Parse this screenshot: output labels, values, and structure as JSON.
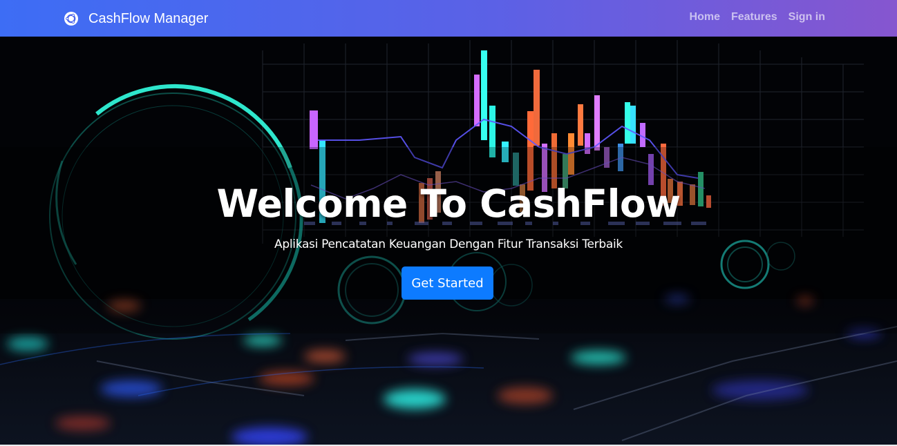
{
  "navbar": {
    "brand": "CashFlow Manager",
    "brand_icon": "ubuntu-logo-icon",
    "links": [
      "Home",
      "Features",
      "Sign in"
    ],
    "gradient_start": "#3d6df5",
    "gradient_end": "#8656cf"
  },
  "hero": {
    "title": "Welcome To CashFlow",
    "subtitle": "Aplikasi Pencatatan Keuangan Dengan Fitur Transaksi Terbaik",
    "cta_label": "Get Started",
    "cta_color": "#0d7bff",
    "background": "dark financial candlestick chart with neon rings"
  }
}
